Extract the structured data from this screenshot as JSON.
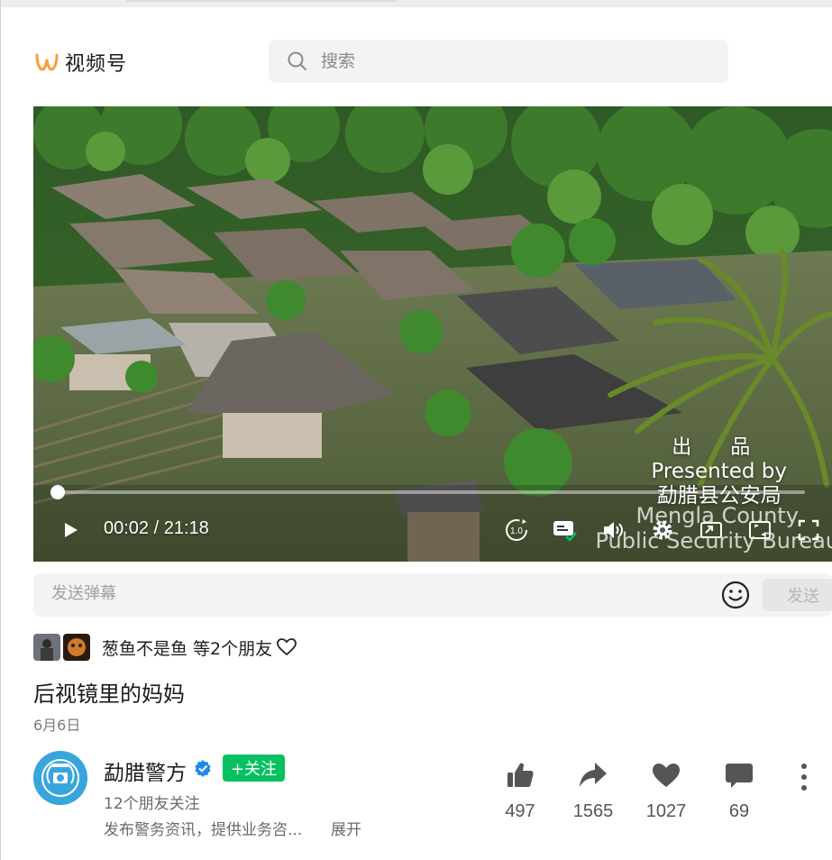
{
  "header": {
    "brand_name": "视频号",
    "brand_icon": "channels-logo-icon",
    "search_placeholder": "搜索"
  },
  "player": {
    "time_text": "00:02 / 21:18",
    "progress_fraction": 0.0016,
    "speed_label": "1.0",
    "overlay": {
      "line1": "出 品",
      "line2": "Presented by",
      "line3": "勐腊县公安局",
      "line4": "Mengla County",
      "line5": "Public Security Bureau"
    }
  },
  "danmu": {
    "placeholder": "发送弹幕",
    "send_label": "发送"
  },
  "friends": {
    "text": "葱鱼不是鱼 等2个朋友"
  },
  "post": {
    "title": "后视镜里的妈妈",
    "date": "6月6日"
  },
  "account": {
    "name": "勐腊警方",
    "follow_label": "+关注",
    "followers_text": "12个朋友关注",
    "description": "发布警务资讯，提供业务咨...",
    "expand_label": "展开"
  },
  "actions": {
    "like_count": "497",
    "share_count": "1565",
    "heart_count": "1027",
    "comment_count": "69"
  },
  "colors": {
    "brand_accent": "#fa9d3b",
    "follow_green": "#07c160",
    "verified_blue": "#1e88e5"
  }
}
